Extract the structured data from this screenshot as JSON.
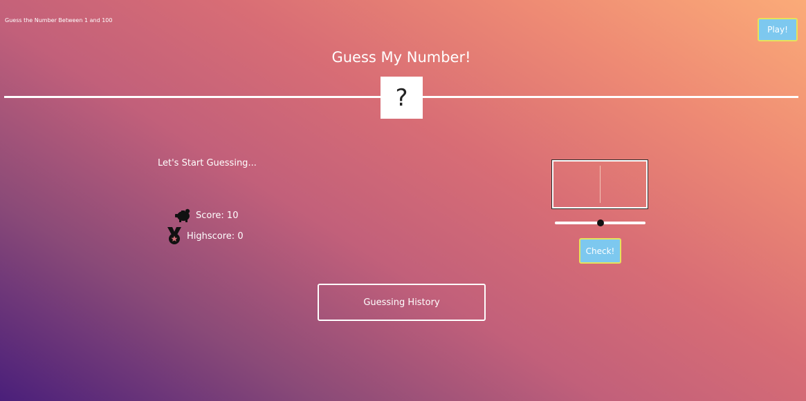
{
  "header": {
    "note": "Guess the Number Between 1 and 100",
    "play_label": "Play!",
    "title": "Guess My Number!"
  },
  "secret": {
    "display": "?"
  },
  "status": {
    "message": "Let's Start Guessing..."
  },
  "stats": {
    "score_text": "Score: 10",
    "highscore_text": "Highscore: 0",
    "score_icon": "piggy-bank-icon",
    "highscore_icon": "medal-icon"
  },
  "guess": {
    "value": "",
    "slider_level": 0.5,
    "check_label": "Check!"
  },
  "history": {
    "button_label": "Guessing History"
  },
  "colors": {
    "button_fill": "#7dc8ef",
    "button_border": "#e6e35a",
    "gradient_start": "#4a1f7a",
    "gradient_mid": "#d86d75",
    "gradient_end": "#fbab78"
  }
}
